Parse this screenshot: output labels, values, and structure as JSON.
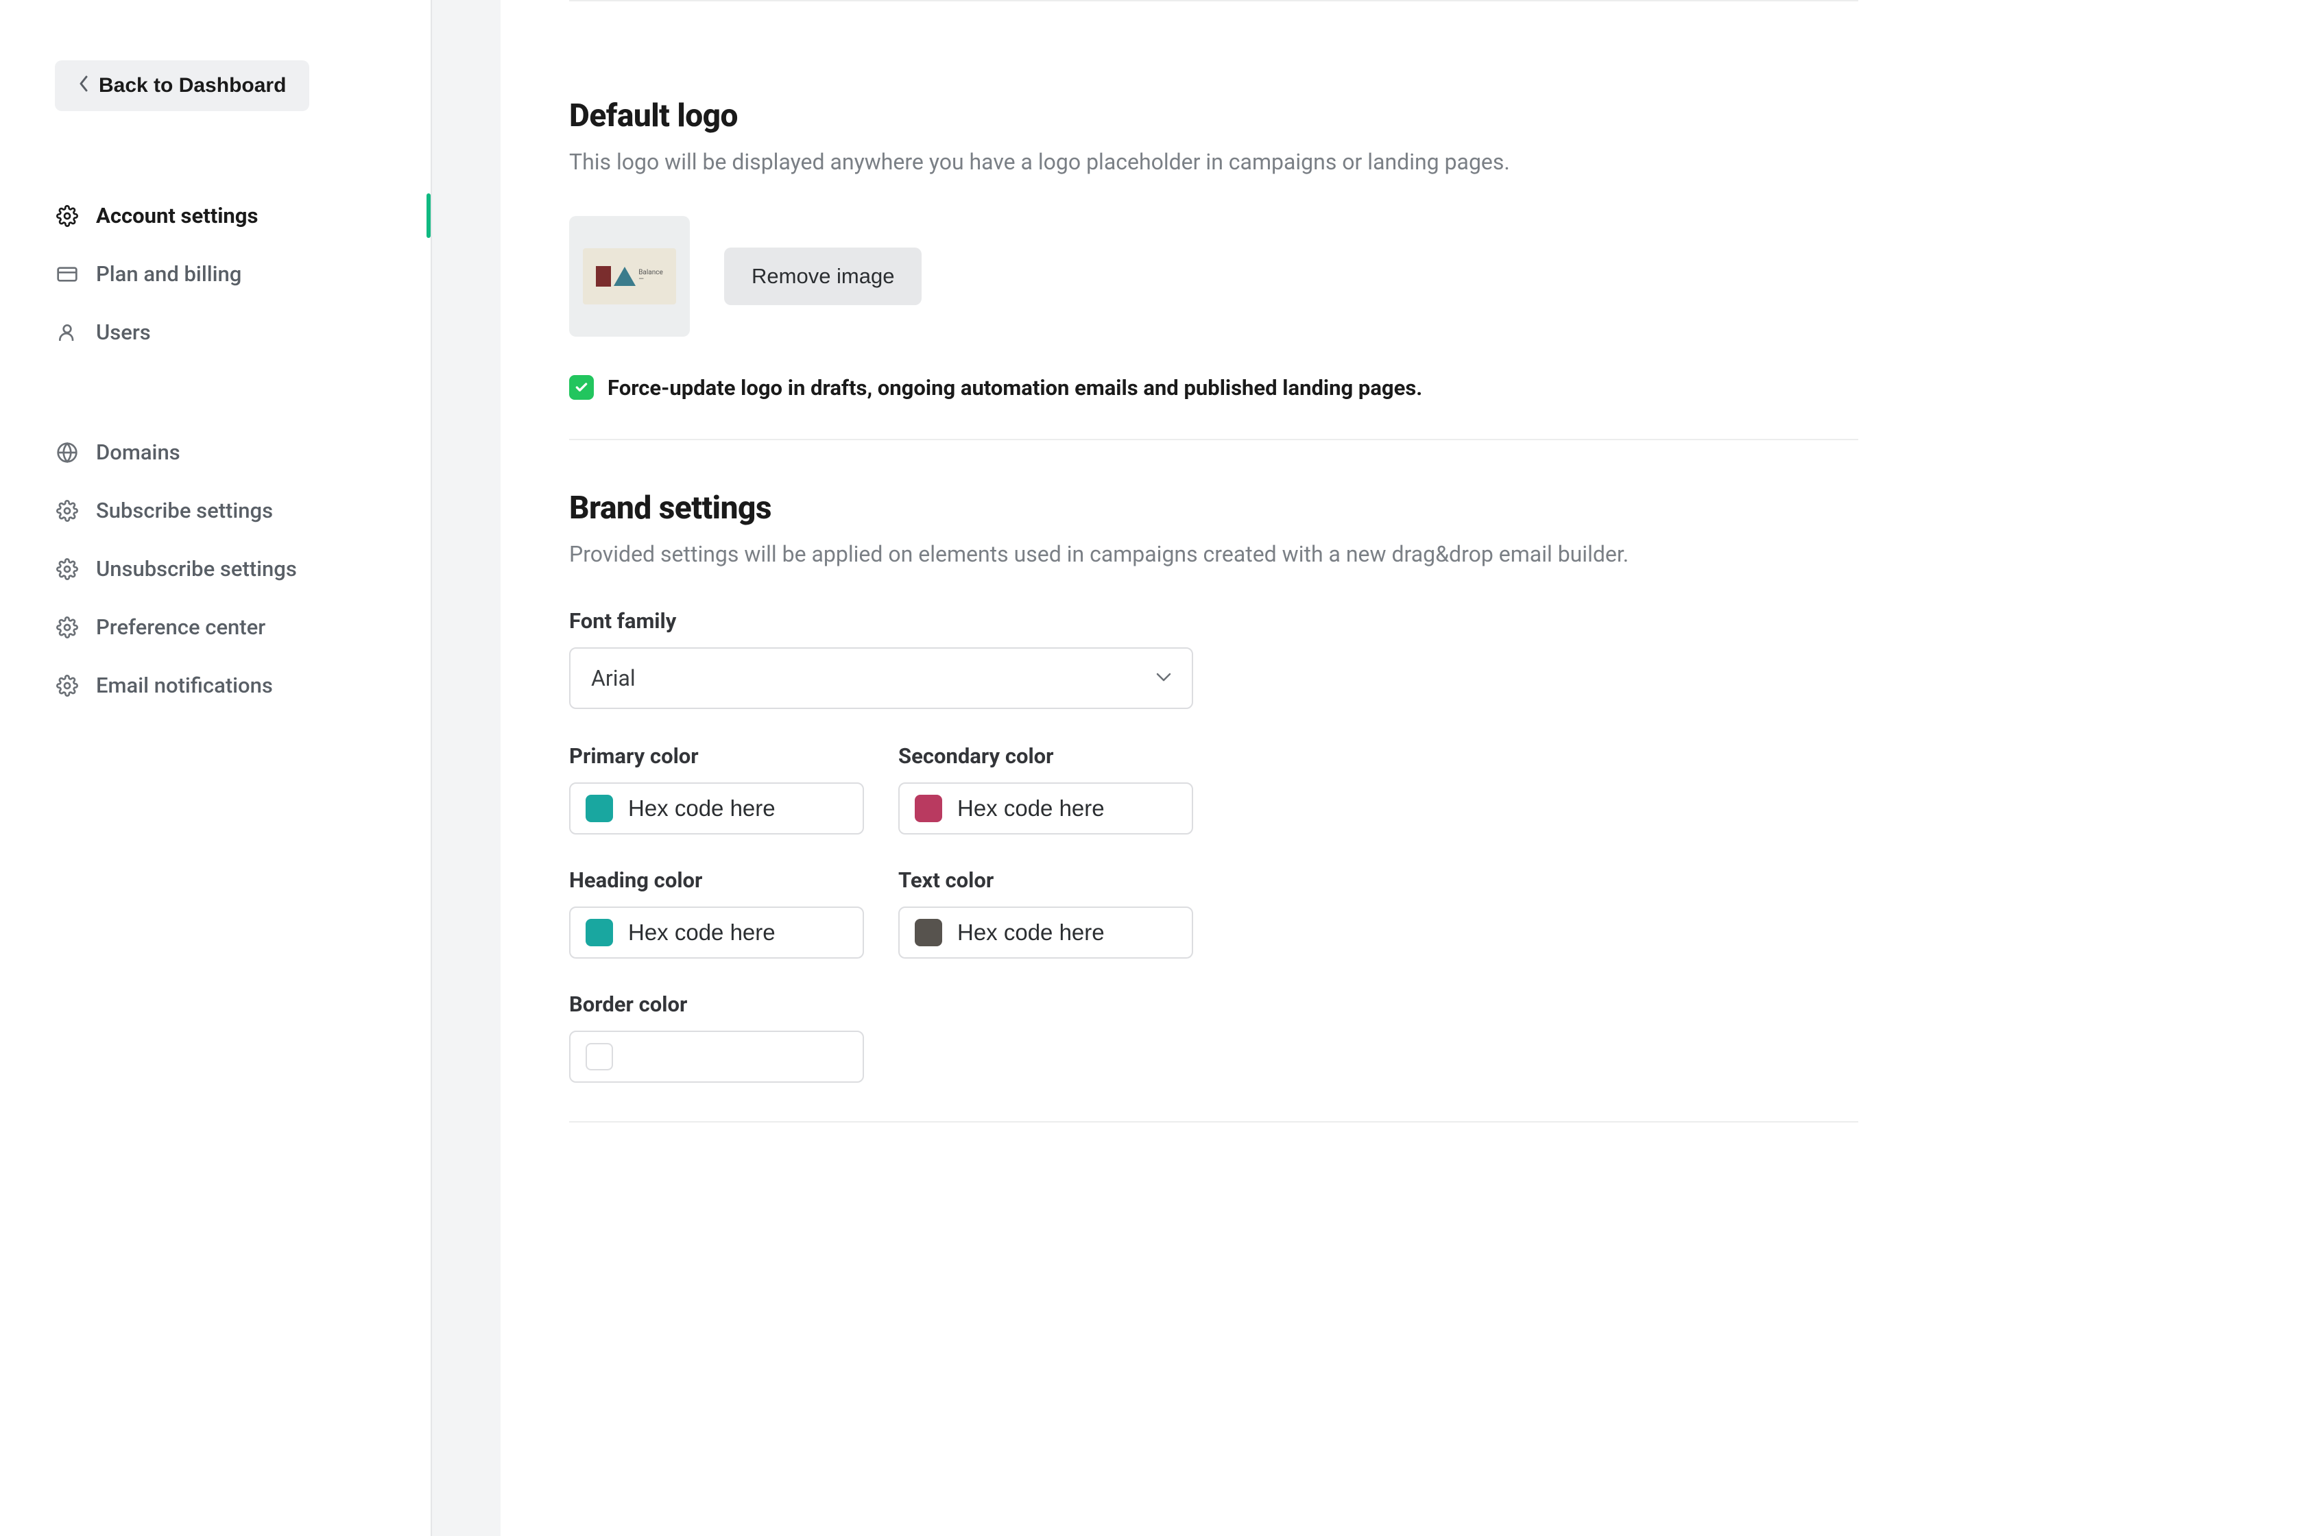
{
  "sidebar": {
    "back_label": "Back to Dashboard",
    "group1": [
      {
        "label": "Account settings",
        "icon": "gear",
        "active": true
      },
      {
        "label": "Plan and billing",
        "icon": "card",
        "active": false
      },
      {
        "label": "Users",
        "icon": "user",
        "active": false
      }
    ],
    "group2": [
      {
        "label": "Domains",
        "icon": "globe"
      },
      {
        "label": "Subscribe settings",
        "icon": "gear"
      },
      {
        "label": "Unsubscribe settings",
        "icon": "gear"
      },
      {
        "label": "Preference center",
        "icon": "gear"
      },
      {
        "label": "Email notifications",
        "icon": "gear"
      }
    ]
  },
  "default_logo": {
    "title": "Default logo",
    "description": "This logo will be displayed anywhere you have a logo placeholder in campaigns or landing pages.",
    "remove_button": "Remove image",
    "checkbox_label": "Force-update logo in drafts, ongoing automation emails and published landing pages.",
    "checkbox_checked": true
  },
  "brand_settings": {
    "title": "Brand settings",
    "description": "Provided settings will be applied on elements used in campaigns created with a new drag&drop email builder.",
    "font_label": "Font family",
    "font_value": "Arial",
    "colors": {
      "primary": {
        "label": "Primary color",
        "placeholder": "Hex code here",
        "swatch": "#19a7a0"
      },
      "secondary": {
        "label": "Secondary color",
        "placeholder": "Hex code here",
        "swatch": "#b93a60"
      },
      "heading": {
        "label": "Heading color",
        "placeholder": "Hex code here",
        "swatch": "#19a7a0"
      },
      "text": {
        "label": "Text color",
        "placeholder": "Hex code here",
        "swatch": "#57534e"
      },
      "border": {
        "label": "Border color",
        "placeholder": "",
        "swatch": ""
      }
    }
  }
}
